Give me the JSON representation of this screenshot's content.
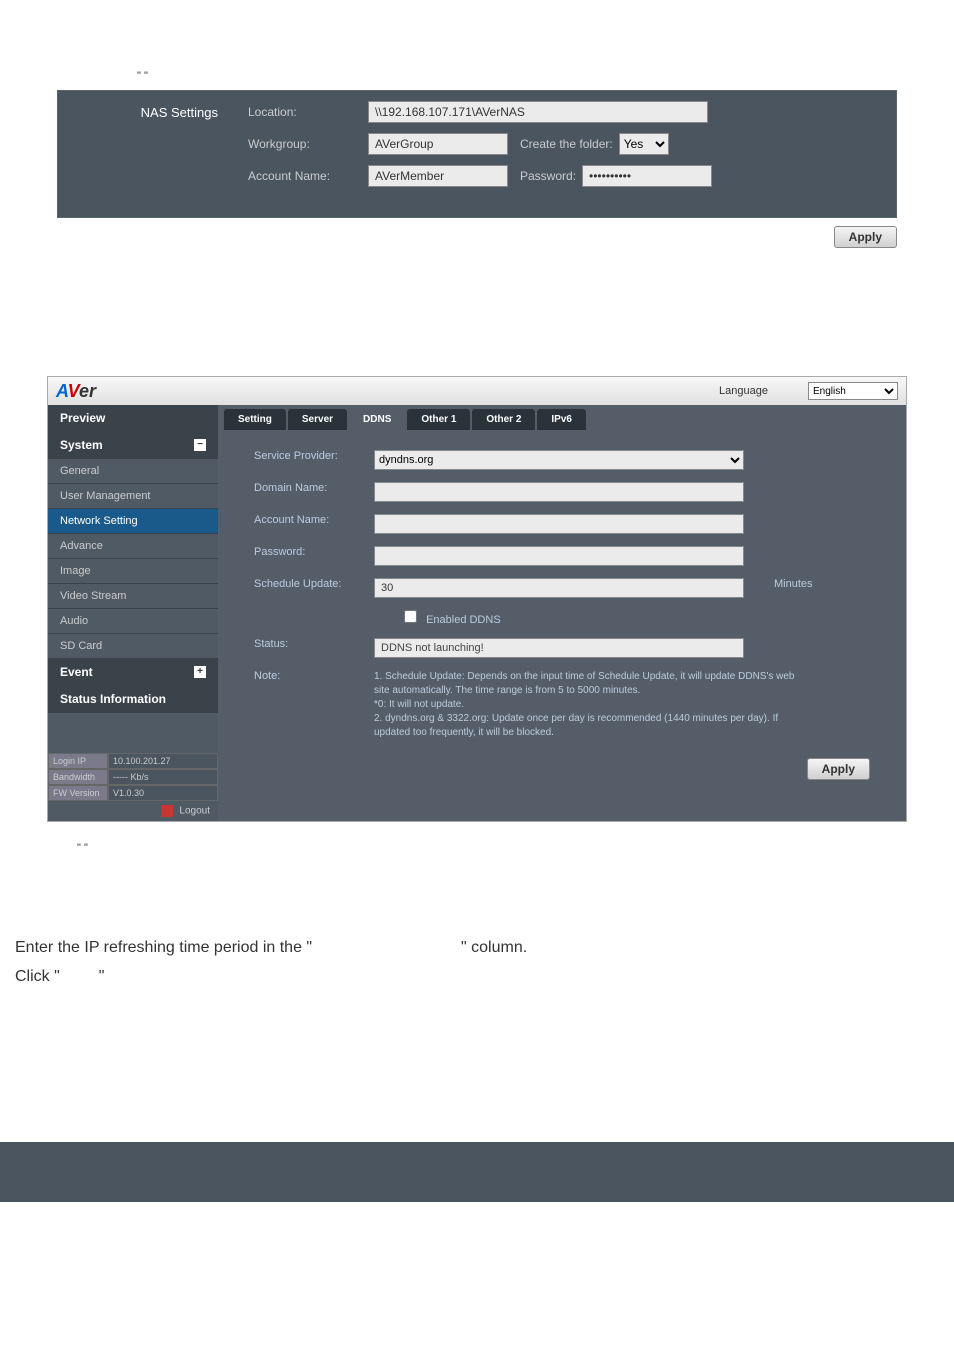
{
  "panel1": {
    "quote": "\"          \"",
    "sectionLabel": "NAS Settings",
    "location": {
      "label": "Location:",
      "value": "\\\\192.168.107.171\\AVerNAS"
    },
    "workgroup": {
      "label": "Workgroup:",
      "value": "AVerGroup"
    },
    "createFolder": {
      "label": "Create the folder:",
      "value": "Yes"
    },
    "accountName": {
      "label": "Account Name:",
      "value": "AVerMember"
    },
    "password": {
      "label": "Password:",
      "value": "••••••••••"
    },
    "applyLabel": "Apply"
  },
  "panel2": {
    "logo": {
      "a": "A",
      "v": "V",
      "er": "er"
    },
    "languageLabel": "Language",
    "languageValue": "English",
    "sidebar": {
      "preview": "Preview",
      "system": "System",
      "items": [
        "General",
        "User Management",
        "Network Setting",
        "Advance",
        "Image",
        "Video Stream",
        "Audio",
        "SD Card"
      ],
      "event": "Event",
      "statusInfo": "Status Information",
      "footer": {
        "loginIp": {
          "label": "Login IP",
          "value": "10.100.201.27"
        },
        "bandwidth": {
          "label": "Bandwidth",
          "value": "----- Kb/s"
        },
        "fwVersion": {
          "label": "FW Version",
          "value": "V1.0.30"
        }
      },
      "logout": "Logout"
    },
    "tabs": [
      "Setting",
      "Server",
      "DDNS",
      "Other 1",
      "Other 2",
      "IPv6"
    ],
    "form": {
      "serviceProvider": {
        "label": "Service Provider:",
        "value": "dyndns.org"
      },
      "domainName": {
        "label": "Domain Name:",
        "value": ""
      },
      "accountName": {
        "label": "Account Name:",
        "value": ""
      },
      "password": {
        "label": "Password:",
        "value": ""
      },
      "scheduleUpdate": {
        "label": "Schedule Update:",
        "value": "30",
        "unit": "Minutes"
      },
      "enabledDdns": "Enabled DDNS",
      "status": {
        "label": "Status:",
        "value": "DDNS not launching!"
      },
      "note": {
        "label": "Note:",
        "text": "1. Schedule Update: Depends on the input time of Schedule Update, it will update DDNS's web site automatically. The time range is from 5 to 5000 minutes.\n*0: It will not update.\n2. dyndns.org & 3322.org: Update once per day is recommended (1440 minutes per day). If updated too frequently, it will be blocked."
      }
    },
    "applyLabel": "Apply"
  },
  "bottomQuote": "\"                                  \"",
  "instructions": {
    "line1a": "Enter the IP refreshing time period in the \"",
    "line1b": "\" column.",
    "line2a": "Click \"",
    "line2b": "\""
  }
}
